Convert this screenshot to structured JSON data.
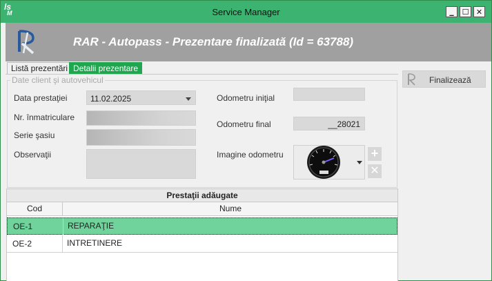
{
  "window": {
    "title": "Service Manager",
    "app_logo": {
      "line1": "ls",
      "line2": "M"
    },
    "controls": {
      "minimize": "▁",
      "maximize": "☐",
      "close": "✕"
    }
  },
  "header": {
    "title": "RAR - Autopass  - Prezentare finalizată (Id = 63788)"
  },
  "tabs": [
    {
      "label": "Listă prezentări",
      "active": false
    },
    {
      "label": "Detalii prezentare",
      "active": true
    }
  ],
  "client_group": {
    "legend": "Date client şi autovehicul",
    "data_prestatiei_label": "Data prestaţiei",
    "data_prestatiei_value": "11.02.2025",
    "nr_inmatriculare_label": "Nr. înmatriculare",
    "serie_sasiu_label": "Serie şasiu",
    "observatii_label": "Observaţii",
    "odometru_initial_label": "Odometru iniţial",
    "odometru_initial_value": "",
    "odometru_final_label": "Odometru final",
    "odometru_final_value": "__28021",
    "imagine_odometru_label": "Imagine odometru"
  },
  "grid": {
    "title": "Prestaţii adăugate",
    "columns": [
      "Cod",
      "Nume"
    ],
    "rows": [
      {
        "cod": "OE-1",
        "nume": "REPARAŢIE",
        "selected": true
      },
      {
        "cod": "OE-2",
        "nume": "INTRETINERE",
        "selected": false
      }
    ]
  },
  "actions": {
    "finalize_label": "Finalizează"
  },
  "colors": {
    "titlebar": "#3cb371",
    "active_tab": "#1fa64f",
    "selected_row": "#6fd39b",
    "header_band": "#a0a0a0"
  }
}
